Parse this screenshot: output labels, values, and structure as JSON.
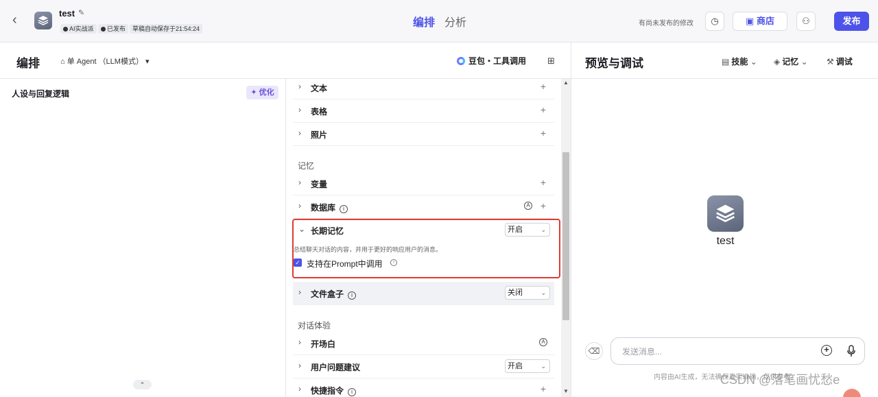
{
  "header": {
    "bot_name": "test",
    "tags": [
      "AI实战派",
      "已发布",
      "草稿自动保存于21:54:24"
    ],
    "tabs": [
      "编排",
      "分析"
    ],
    "unpublished_hint": "有尚未发布的修改",
    "store_label": "商店",
    "publish_label": "发布"
  },
  "edit": {
    "title": "编排",
    "agent_mode": "单 Agent （LLM模式）",
    "model_name": "豆包・工具调用",
    "persona_title": "人设与回复逻辑",
    "optimize_label": "优化"
  },
  "skills": {
    "top_items": [
      "文本",
      "表格",
      "照片"
    ],
    "memory_section": "记忆",
    "variables_label": "变量",
    "database_label": "数据库",
    "ltm_label": "长期记忆",
    "ltm_state": "开启",
    "ltm_desc": "总结聊天对话的内容，并用于更好的响应用户的消息。",
    "ltm_prompt_label": "支持在Prompt中调用",
    "filebox_label": "文件盒子",
    "filebox_state": "关闭",
    "chat_section": "对话体验",
    "opening_label": "开场白",
    "suggest_label": "用户问题建议",
    "suggest_state": "开启",
    "shortcut_label": "快捷指令"
  },
  "preview": {
    "title": "预览与调试",
    "skills_btn": "技能",
    "memory_btn": "记忆",
    "debug_btn": "调试",
    "bot_title": "test",
    "input_placeholder": "发送消息...",
    "footer_note": "内容由AI生成，无法确保真实准确，仅供参考。",
    "watermark": "CSDN @落笔画忧愁e"
  },
  "colors": {
    "accent": "#4d53e8",
    "highlight": "#e2392f",
    "optimize_bg": "#e9e7fc"
  }
}
